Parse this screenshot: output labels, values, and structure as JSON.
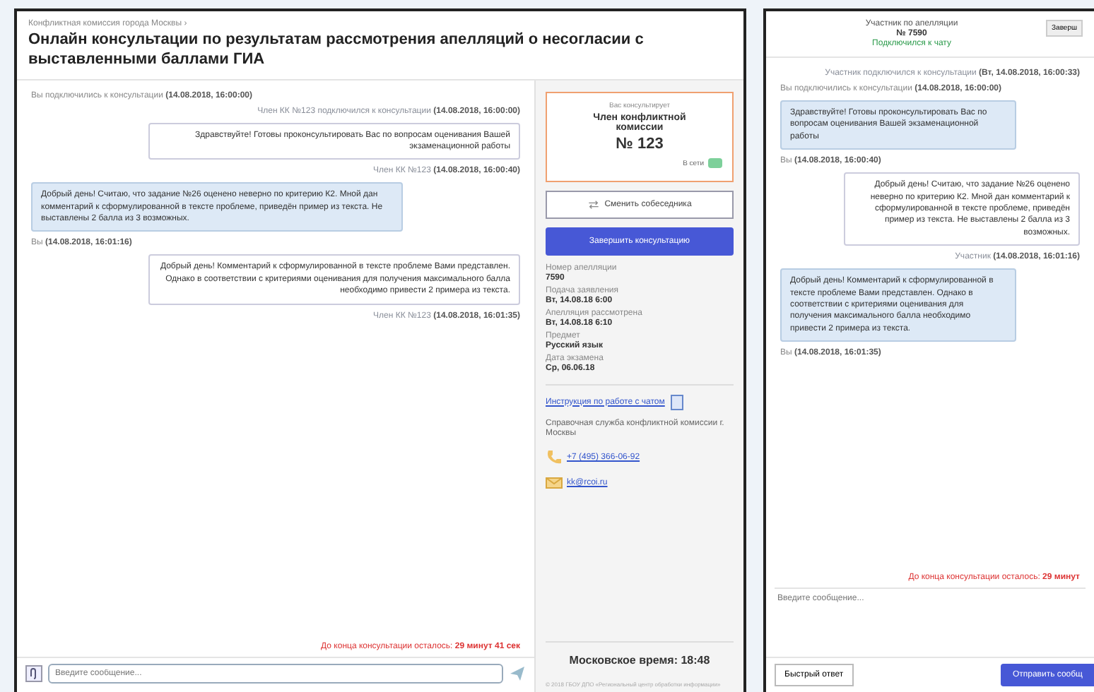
{
  "member_window": {
    "breadcrumb": "Конфликтная комиссия города Москвы ›",
    "title": "Онлайн консультации по результатам рассмотрения апелляций о несогласии с выставленными баллами ГИА",
    "messages": [
      {
        "kind": "notice",
        "incoming": true,
        "text": "Вы подключились к консультации **(14.08.2018, 16:00:00)**"
      },
      {
        "kind": "notice",
        "incoming": false,
        "text": "Член КК №123 подключился к консультации **(14.08.2018, 16:00:00)**"
      },
      {
        "kind": "bubble",
        "incoming": false,
        "text": "Здравствуйте! Готовы проконсультировать Вас по вопросам оценивания Вашей экзаменационной работы"
      },
      {
        "kind": "notice",
        "incoming": false,
        "text": "Член КК №123 **(14.08.2018, 16:00:40)**"
      },
      {
        "kind": "bubble",
        "incoming": true,
        "text": "Добрый день! Считаю, что задание №26 оценено неверно по критерию К2. Мной дан комментарий к сформулированной в тексте проблеме, приведён пример из текста. Не выставлены 2 балла из 3 возможных."
      },
      {
        "kind": "notice",
        "incoming": true,
        "text": "Вы **(14.08.2018, 16:01:16)**"
      },
      {
        "kind": "bubble",
        "incoming": false,
        "text": "Добрый день! Комментарий к сформулированной в тексте проблеме Вами представлен. Однако в соответствии с критериями оценивания для получения максимального балла необходимо привести 2 примера из текста."
      },
      {
        "kind": "notice",
        "incoming": false,
        "text": "Член КК №123 **(14.08.2018, 16:01:35)**"
      }
    ],
    "timer": "До конца консультации осталось: **29 минут 41 сек**",
    "input": {
      "placeholder": "Введите сообщение..."
    },
    "sidebar": {
      "card": {
        "caption": "Вас консультирует",
        "role": "Член конфликтной комиссии",
        "number": "№ 123",
        "status": "В сети"
      },
      "change_button": "Сменить собеседника",
      "finish_button": "Завершить консультацию",
      "fields": [
        {
          "label": "Номер апелляции",
          "value": "7590"
        },
        {
          "label": "Подача заявления",
          "value": "Вт, 14.08.18 6:00"
        },
        {
          "label": "Апелляция рассмотрена",
          "value": "Вт, 14.08.18 6:10"
        },
        {
          "label": "Предмет",
          "value": "Русский язык"
        },
        {
          "label": "Дата экзамена",
          "value": "Ср, 06.06.18"
        }
      ],
      "instruction_link": "Инструкция по работе с чатом",
      "help_text": "Справочная служба конфликтной комиссии г. Москвы",
      "contacts": [
        {
          "kind": "phone",
          "text": "+7 (495) 366-06-92"
        },
        {
          "kind": "email",
          "text": "kk@rcoi.ru"
        }
      ],
      "clock": "Московское время: 18:48",
      "footer": "© 2018 ГБОУ ДПО «Региональный центр обработки информации»"
    }
  },
  "participant_window": {
    "role": "Участник по апелляции",
    "number": "№ 7590",
    "status": "Подключился к чату",
    "finish_button": "Заверш",
    "messages": [
      {
        "kind": "notice",
        "incoming": false,
        "text": "Участник подключился к консультации **(Вт, 14.08.2018, 16:00:33)**"
      },
      {
        "kind": "notice",
        "incoming": true,
        "text": "Вы подключились к консультации **(14.08.2018, 16:00:00)**"
      },
      {
        "kind": "bubble",
        "incoming": true,
        "text": "Здравствуйте! Готовы проконсультировать Вас по вопросам оценивания Вашей экзаменационной работы"
      },
      {
        "kind": "notice",
        "incoming": true,
        "text": "Вы **(14.08.2018, 16:00:40)**"
      },
      {
        "kind": "bubble",
        "incoming": false,
        "text": "Добрый день! Считаю, что задание №26 оценено неверно по критерию К2. Мной дан комментарий к сформулированной в тексте проблеме, приведён пример из текста. Не выставлены 2 балла из 3 возможных."
      },
      {
        "kind": "notice",
        "incoming": false,
        "text": "Участник **(14.08.2018, 16:01:16)**"
      },
      {
        "kind": "bubble",
        "incoming": true,
        "text": "Добрый день! Комментарий к сформулированной в тексте проблеме Вами представлен. Однако в соответствии с критериями оценивания для получения максимального балла необходимо привести 2 примера из текста."
      },
      {
        "kind": "notice",
        "incoming": true,
        "text": "Вы **(14.08.2018, 16:01:35)**"
      }
    ],
    "timer": "До конца консультации осталось: **29 минут**",
    "input": {
      "placeholder": "Введите сообщение..."
    },
    "quick_button": "Быстрый ответ",
    "send_button": "Отправить сообщ"
  }
}
